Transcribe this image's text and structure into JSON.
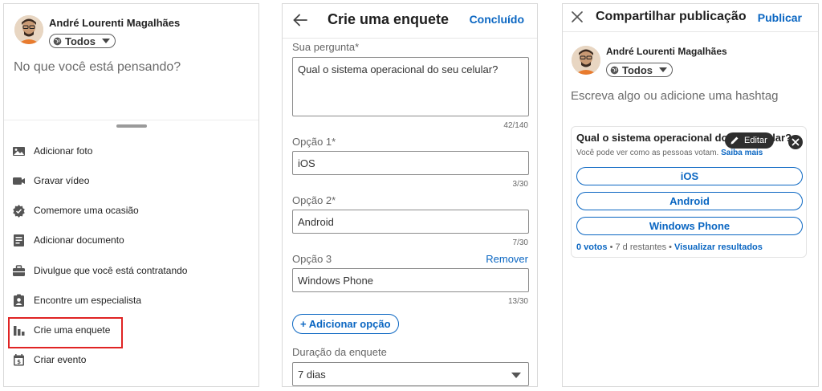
{
  "panel1": {
    "user_name": "André Lourenti Magalhães",
    "audience": "Todos",
    "placeholder": "No que você está pensando?",
    "menu": [
      {
        "label": "Adicionar foto",
        "icon": "image-icon"
      },
      {
        "label": "Gravar vídeo",
        "icon": "video-icon"
      },
      {
        "label": "Comemore uma ocasião",
        "icon": "badge-icon"
      },
      {
        "label": "Adicionar documento",
        "icon": "document-icon"
      },
      {
        "label": "Divulgue que você está contratando",
        "icon": "briefcase-icon"
      },
      {
        "label": "Encontre um especialista",
        "icon": "person-badge-icon"
      },
      {
        "label": "Crie uma enquete",
        "icon": "poll-icon"
      },
      {
        "label": "Criar evento",
        "icon": "calendar-icon"
      }
    ]
  },
  "panel2": {
    "title": "Crie uma enquete",
    "done": "Concluído",
    "question_label": "Sua pergunta*",
    "question_value": "Qual o sistema operacional do seu celular?",
    "question_counter": "42/140",
    "option1_label": "Opção 1*",
    "option1_value": "iOS",
    "option1_counter": "3/30",
    "option2_label": "Opção 2*",
    "option2_value": "Android",
    "option2_counter": "7/30",
    "option3_label": "Opção 3",
    "option3_remove": "Remover",
    "option3_value": "Windows Phone",
    "option3_counter": "13/30",
    "add_option": "+ Adicionar opção",
    "duration_label": "Duração da enquete",
    "duration_value": "7 dias"
  },
  "panel3": {
    "title": "Compartilhar publicação",
    "publish": "Publicar",
    "user_name": "André Lourenti Magalhães",
    "audience": "Todos",
    "placeholder": "Escreva algo ou adicione uma hashtag",
    "poll": {
      "question": "Qual o sistema operacional do seu celular?",
      "subtitle": "Você pode ver como as pessoas votam.",
      "learn_more": "Saiba mais",
      "options": [
        "iOS",
        "Android",
        "Windows Phone"
      ],
      "votes": "0 votos",
      "remaining": " • 7 d restantes • ",
      "view_results": "Visualizar resultados"
    },
    "edit_label": "Editar"
  },
  "colors": {
    "accent": "#0a66c2",
    "highlight": "#e02424"
  }
}
